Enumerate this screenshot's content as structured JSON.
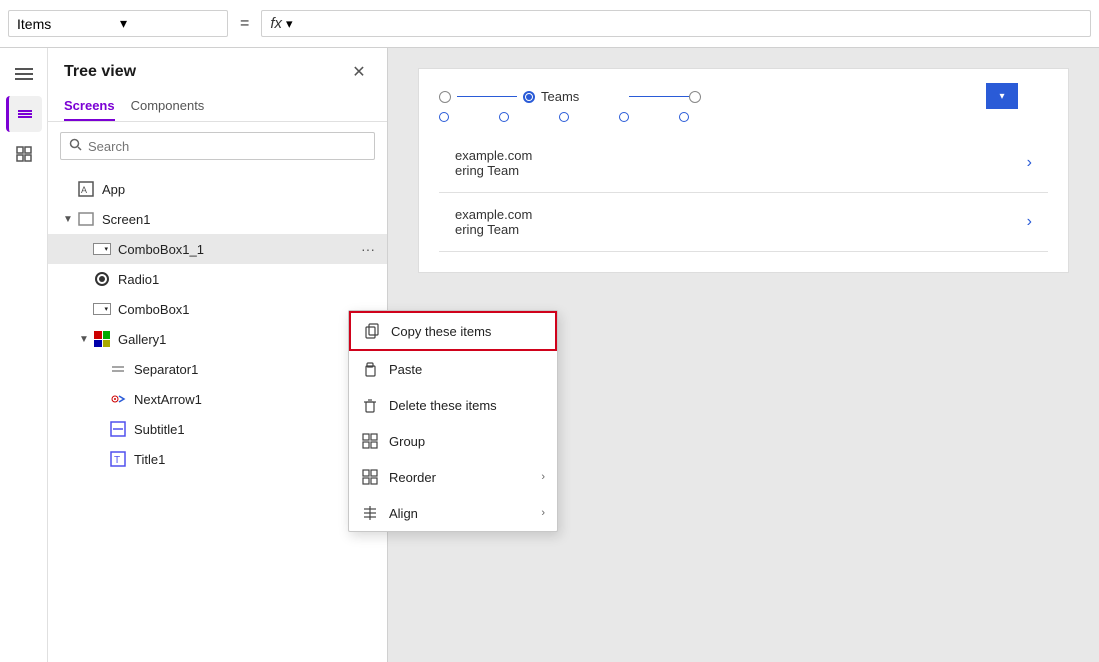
{
  "topbar": {
    "dropdown_label": "Items",
    "equals": "=",
    "fx_label": "fx",
    "chevron_down": "▾"
  },
  "left_sidebar": {
    "icons": [
      {
        "name": "hamburger-menu",
        "symbol": "☰"
      },
      {
        "name": "layers",
        "symbol": "⧉"
      },
      {
        "name": "components",
        "symbol": "⊞"
      }
    ]
  },
  "tree_panel": {
    "title": "Tree view",
    "close_label": "✕",
    "tabs": [
      {
        "label": "Screens",
        "active": true
      },
      {
        "label": "Components",
        "active": false
      }
    ],
    "search_placeholder": "Search",
    "items": [
      {
        "label": "App",
        "type": "app",
        "depth": 0,
        "has_chevron": false
      },
      {
        "label": "Screen1",
        "type": "screen",
        "depth": 0,
        "has_chevron": true,
        "expanded": true
      },
      {
        "label": "ComboBox1_1",
        "type": "combobox",
        "depth": 1,
        "has_chevron": false,
        "selected": true,
        "show_more": true
      },
      {
        "label": "Radio1",
        "type": "radio",
        "depth": 1,
        "has_chevron": false
      },
      {
        "label": "ComboBox1",
        "type": "combobox",
        "depth": 1,
        "has_chevron": false
      },
      {
        "label": "Gallery1",
        "type": "gallery",
        "depth": 1,
        "has_chevron": true,
        "expanded": true
      },
      {
        "label": "Separator1",
        "type": "separator",
        "depth": 2,
        "has_chevron": false
      },
      {
        "label": "NextArrow1",
        "type": "nextarrow",
        "depth": 2,
        "has_chevron": false
      },
      {
        "label": "Subtitle1",
        "type": "subtitle",
        "depth": 2,
        "has_chevron": false
      },
      {
        "label": "Title1",
        "type": "title",
        "depth": 2,
        "has_chevron": false
      }
    ]
  },
  "context_menu": {
    "items": [
      {
        "label": "Copy these items",
        "icon": "copy",
        "highlighted": true,
        "has_arrow": false
      },
      {
        "label": "Paste",
        "icon": "paste",
        "highlighted": false,
        "has_arrow": false
      },
      {
        "label": "Delete these items",
        "icon": "delete",
        "highlighted": false,
        "has_arrow": false
      },
      {
        "label": "Group",
        "icon": "group",
        "highlighted": false,
        "has_arrow": false
      },
      {
        "label": "Reorder",
        "icon": "reorder",
        "highlighted": false,
        "has_arrow": true
      },
      {
        "label": "Align",
        "icon": "align",
        "highlighted": false,
        "has_arrow": true
      }
    ]
  },
  "canvas": {
    "radio_label": "Teams",
    "list_items": [
      {
        "text1": "example.com",
        "text2": "ering Team"
      },
      {
        "text1": "example.com",
        "text2": "ering Team"
      }
    ]
  }
}
